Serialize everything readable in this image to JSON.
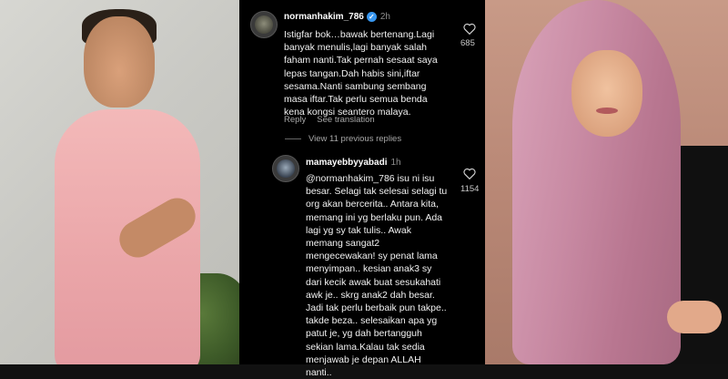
{
  "comment_1": {
    "username": "normanhakim_786",
    "time": "2h",
    "text": "Istigfar bok…bawak bertenang.Lagi\nbanyak menulis,lagi banyak salah\nfaham nanti.Tak pernah sesaat saya\nlepas tangan.Dah habis sini,iftar\nsesama.Nanti sambung sembang\nmasa iftar.Tak perlu semua benda\nkena kongsi seantero malaya.",
    "likes": "685",
    "reply_label": "Reply",
    "translation_label": "See translation"
  },
  "view_more_label": "View 11 previous replies",
  "comment_2": {
    "username": "mamayebbyyabadi",
    "time": "1h",
    "text": "@normanhakim_786 isu ni isu\nbesar. Selagi tak selesai selagi tu\norg akan bercerita.. Antara kita,\nmemang ini yg berlaku pun. Ada\nlagi yg sy tak tulis.. Awak\nmemang sangat2\nmengecewakan! sy penat lama\nmenyimpan.. kesian anak3 sy\ndari kecik awak buat sesukahati\nawk je.. skrg anak2 dah besar.\nJadi tak perlu berbaik pun takpe..\ntakde beza.. selesaikan apa yg\npatut je, yg dah bertangguh\nsekian lama.Kalau tak sedia\nmenjawab je depan ALLAH\nnanti..",
    "likes": "1154"
  },
  "colors": {
    "background": "#000000",
    "verified": "#3897f0",
    "muted_text": "#a8a8a8"
  },
  "icons": [
    "verified-badge-icon",
    "heart-icon"
  ]
}
